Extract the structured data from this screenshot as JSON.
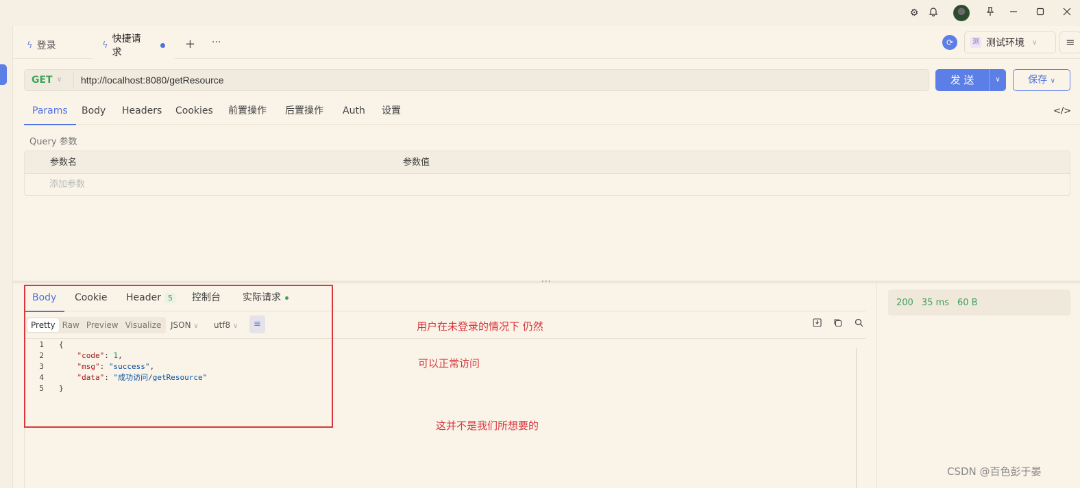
{
  "tabs": [
    {
      "label": "登录",
      "active": false
    },
    {
      "label": "快捷请求",
      "active": true
    }
  ],
  "tab_actions": {
    "add": "+",
    "more": "···"
  },
  "environment": {
    "badge": "测",
    "name": "测试环境"
  },
  "request": {
    "method": "GET",
    "url": "http://localhost:8080/getResource",
    "send_label": "发 送",
    "save_label": "保存"
  },
  "request_tabs": [
    "Params",
    "Body",
    "Headers",
    "Cookies",
    "前置操作",
    "后置操作",
    "Auth",
    "设置"
  ],
  "params": {
    "section_label": "Query 参数",
    "col_name": "参数名",
    "col_value": "参数值",
    "add_placeholder": "添加参数"
  },
  "response_tabs": {
    "body": "Body",
    "cookie": "Cookie",
    "header": "Header",
    "header_count": "5",
    "console": "控制台",
    "actual_request": "实际请求"
  },
  "format_bar": {
    "modes": [
      "Pretty",
      "Raw",
      "Preview",
      "Visualize"
    ],
    "type": "JSON",
    "encoding": "utf8"
  },
  "response_body": {
    "line_numbers": [
      "1",
      "2",
      "3",
      "4",
      "5"
    ],
    "open_brace": "{",
    "close_brace": "}",
    "code_key": "\"code\"",
    "code_val": "1",
    "msg_key": "\"msg\"",
    "msg_val": "\"success\"",
    "data_key": "\"data\"",
    "data_val": "\"成功访问/getResource\""
  },
  "status": {
    "code": "200",
    "time": "35 ms",
    "size": "60 B"
  },
  "annotations": [
    "用户在未登录的情况下 仍然",
    "可以正常访问",
    "这并不是我们所想要的"
  ],
  "annotation_color": "#d9363e",
  "accent_color": "#5b7fe6",
  "watermark": "CSDN @百色彭于晏"
}
